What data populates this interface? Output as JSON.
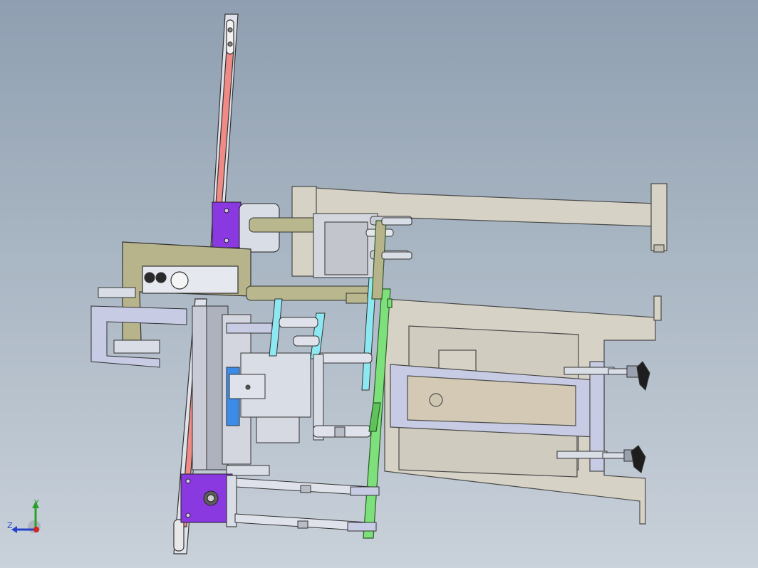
{
  "viewport": {
    "background_top": "#8f9fb1",
    "background_bottom": "#c9d1da"
  },
  "triad": {
    "y_label": "Y",
    "z_label": "Z",
    "y_color": "#2aa12a",
    "z_color": "#2442c8",
    "x_color": "#d2231f"
  },
  "colors": {
    "frame_beige": "#d6d2c6",
    "frame_outline": "#4a4a4a",
    "steel_light": "#d9dde6",
    "steel_blue": "#c7cbe3",
    "rail_salmon": "#f08a85",
    "motor_purple": "#8a38e0",
    "plate_olive": "#b7b38a",
    "guide_rod": "#b9b78e",
    "green_bar": "#7ee07a",
    "cyan_strip": "#8ee8f2",
    "blue_block": "#3c8be8",
    "rubber_black": "#1e1e1e"
  }
}
